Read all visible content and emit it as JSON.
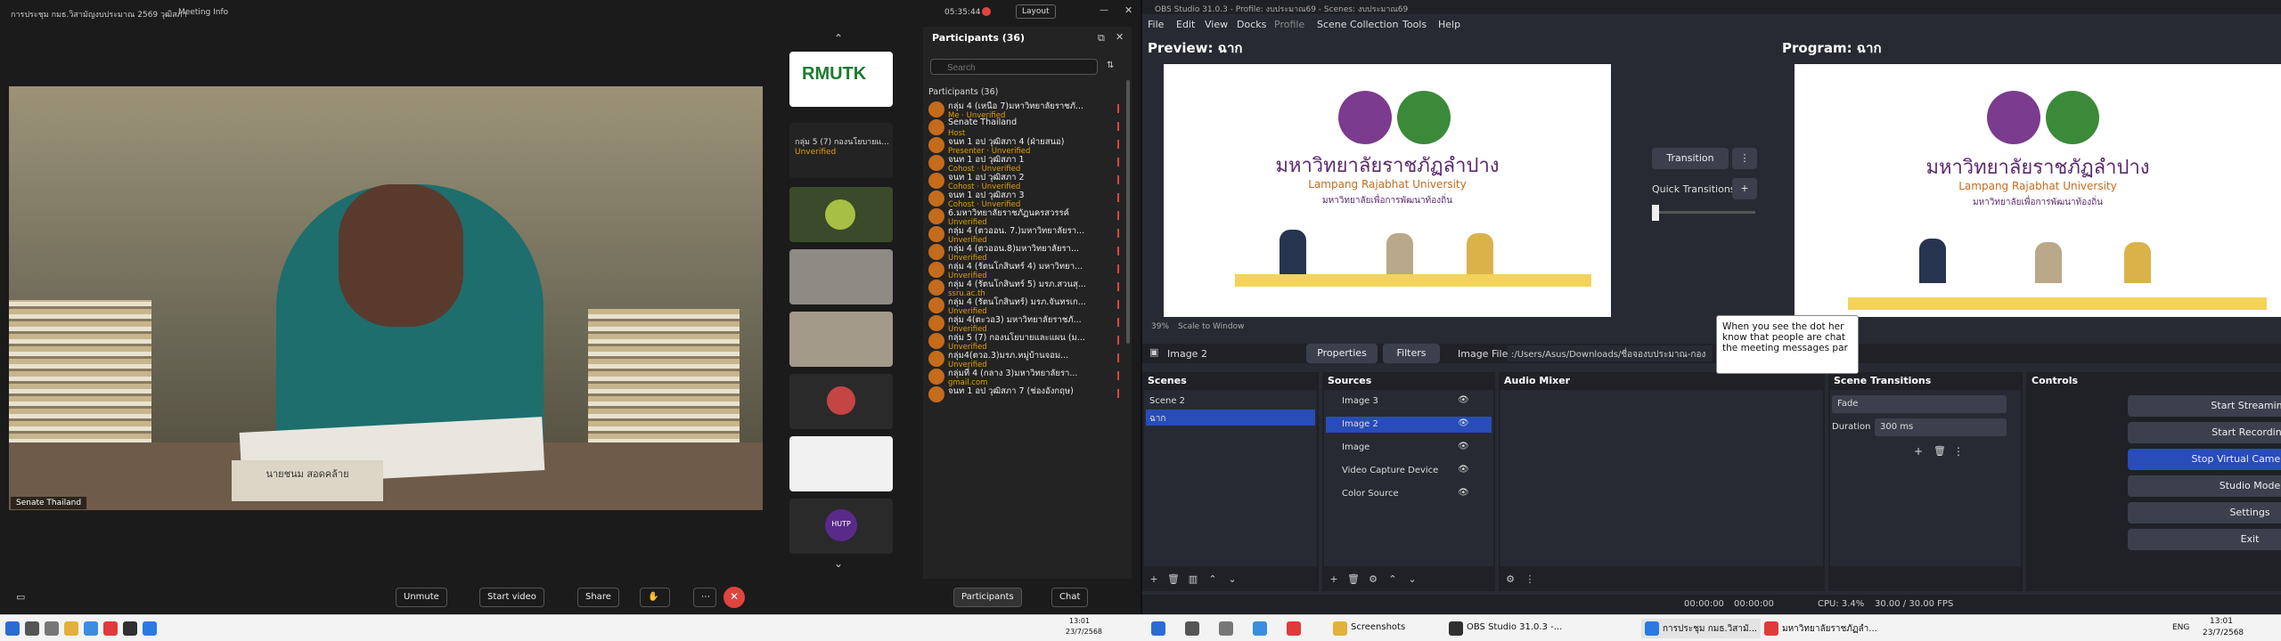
{
  "zoom": {
    "title": "การประชุม กมธ.วิสามัญงบประมาณ 2569 วุฒิสภา",
    "meeting_info": "Meeting Info",
    "time": "05:35:44",
    "layout_label": "Layout",
    "video_label": "Senate Thailand",
    "nameplate": "นายชนม สอดคล้าย",
    "thumbs": [
      {
        "label": "RMUTK"
      },
      {
        "label": "กลุ่ม 5 (7) กองนโยบายแ..."
      },
      {
        "label": "Unverified"
      },
      {
        "label": ""
      },
      {
        "label": ""
      },
      {
        "label": ""
      },
      {
        "label": ""
      },
      {
        "label": ""
      },
      {
        "label": "HUTP"
      }
    ],
    "participants_title": "Participants (36)",
    "search_placeholder": "Search",
    "section_label": "Participants (36)",
    "participants": [
      {
        "name": "กลุ่ม 4 (เหนือ 7)มหาวิทยาลัยราชภั...",
        "sub": "Me · Unverified"
      },
      {
        "name": "Senate Thailand",
        "sub": "Host"
      },
      {
        "name": "จนท 1 อป วุฒิสภา 4 (ฝ่ายสนอ)",
        "sub": "Presenter · Unverified"
      },
      {
        "name": "จนท 1 อป วุฒิสภา 1",
        "sub": "Cohost · Unverified"
      },
      {
        "name": "จนท 1 อป วุฒิสภา 2",
        "sub": "Cohost · Unverified"
      },
      {
        "name": "จนท 1 อป วุฒิสภา 3",
        "sub": "Cohost · Unverified"
      },
      {
        "name": "6.มหาวิทยาลัยราชภัฏนครสวรรค์",
        "sub": "Unverified"
      },
      {
        "name": "กลุ่ม 4 (ตวออน. 7.)มหาวิทยาลัยรา...",
        "sub": "Unverified"
      },
      {
        "name": "กลุ่ม 4 (ตวออน.8)มหาวิทยาลัยรา...",
        "sub": "Unverified"
      },
      {
        "name": "กลุ่ม 4 (รัตนโกสินทร์ 4) มหาวิทยา...",
        "sub": "Unverified"
      },
      {
        "name": "กลุ่ม 4 (รัตนโกสินทร์ 5) มรภ.สวนสุ...",
        "sub": "ssru.ac.th"
      },
      {
        "name": "กลุ่ม 4 (รัตนโกสินทร์) มรภ.จันทรเก...",
        "sub": "Unverified"
      },
      {
        "name": "กลุ่ม 4(ตะวอ3) มหาวิทยาลัยราชภั...",
        "sub": "Unverified"
      },
      {
        "name": "กลุ่ม 5 (7) กองนโยบายและแผน (ม...",
        "sub": "Unverified"
      },
      {
        "name": "กลุ่ม4(ตวอ.3)มรภ.หมู่บ้านจอม...",
        "sub": "Unverified"
      },
      {
        "name": "กลุ่มที่ 4 (กลาง 3)มหาวิทยาลัยรา...",
        "sub": "gmail.com"
      },
      {
        "name": "จนท 1 อป วุฒิสภา 7 (ช่องอังกฤษ)",
        "sub": ""
      }
    ],
    "bottom": {
      "unmute": "Unmute",
      "start_video": "Start video",
      "share": "Share",
      "participants": "Participants",
      "chat": "Chat"
    }
  },
  "obs": {
    "window_title": "OBS Studio 31.0.3 - Profile: งบประมาณ69 - Scenes: งบประมาณ69",
    "menu": [
      "File",
      "Edit",
      "View",
      "Docks",
      "Profile",
      "Scene Collection",
      "Tools",
      "Help"
    ],
    "preview_label": "Preview: ฉาก",
    "program_label": "Program: ฉาก",
    "banner_title": "มหาวิทยาลัยราชภัฏลำปาง",
    "banner_sub": "Lampang Rajabhat University",
    "banner_tag": "มหาวิทยาลัยเพื่อการพัฒนาท้องถิ่น",
    "zoom_level": "39%",
    "scale_label": "Scale to Window",
    "transition_btn": "Transition",
    "quick_transitions": "Quick Transitions",
    "source_name": "Image 2",
    "properties_btn": "Properties",
    "filters_btn": "Filters",
    "image_file_label": "Image File",
    "image_file_value": ":/Users/Asus/Downloads/ชื่อจองบประมาณ-กอง",
    "scenes_title": "Scenes",
    "scenes": [
      "Scene 2",
      "ฉาก"
    ],
    "sources_title": "Sources",
    "sources": [
      "Image 3",
      "Image 2",
      "Image",
      "Video Capture Device",
      "Color Source"
    ],
    "audio_title": "Audio Mixer",
    "transitions_title": "Scene Transitions",
    "transition_type": "Fade",
    "duration_label": "Duration",
    "duration_value": "300 ms",
    "controls_title": "Controls",
    "controls": [
      "Start Streaming",
      "Start Recording",
      "Stop Virtual Camera",
      "Studio Mode",
      "Settings",
      "Exit"
    ],
    "status": {
      "rec1": "00:00:00",
      "rec2": "00:00:00",
      "cpu": "CPU: 3.4%",
      "fps": "30.00 / 30.00 FPS"
    },
    "tooltip": "When you see the dot her know that people are chat the meeting messages par"
  },
  "taskbar": {
    "left_time": "13:01",
    "left_date": "23/7/2568",
    "items": [
      "Screenshots",
      "OBS Studio 31.0.3 -...",
      "การประชุม กมธ.วิสามั...",
      "มหาวิทยาลัยราชภัฏลำ..."
    ],
    "lang": "ENG",
    "right_time": "13:01",
    "right_date": "23/7/2568"
  }
}
